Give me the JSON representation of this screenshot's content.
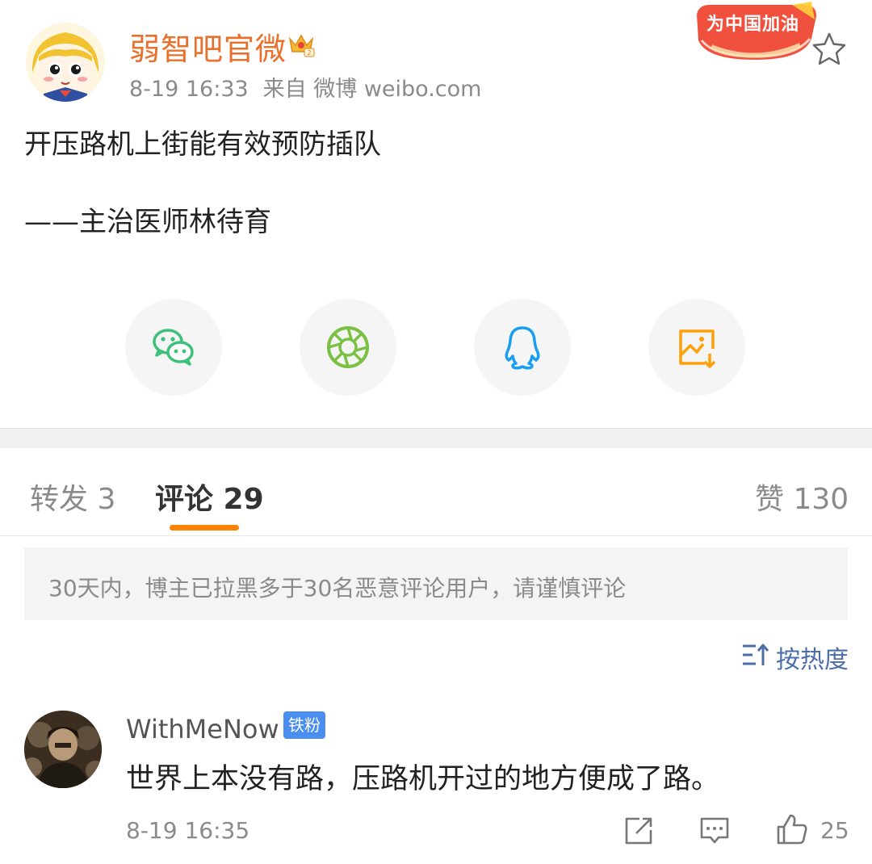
{
  "post": {
    "author": "弱智吧官微",
    "time": "8-19 16:33",
    "source": "来自 微博 weibo.com",
    "cheer_badge": "为中国加油",
    "lines": [
      "开压路机上街能有效预防插队",
      "——主治医师林待育"
    ]
  },
  "share": {
    "items": [
      {
        "icon": "wechat-icon",
        "color": "#3dc17a"
      },
      {
        "icon": "moments-icon",
        "color": "#7ac143"
      },
      {
        "icon": "qq-icon",
        "color": "#1a9ff0"
      },
      {
        "icon": "save-image-icon",
        "color": "#ff9f0a"
      }
    ]
  },
  "tabs": {
    "repost": "转发 3",
    "comments": "评论 29",
    "likes": "赞 130",
    "accent": "#ff8200"
  },
  "notice": "30天内，博主已拉黑多于30名恶意评论用户，请谨慎评论",
  "sort": {
    "label": "按热度"
  },
  "comment": {
    "user": "WithMeNow",
    "badge": "铁粉",
    "text": "世界上本没有路，压路机开过的地方便成了路。",
    "time": "8-19 16:35",
    "likes": "25"
  }
}
